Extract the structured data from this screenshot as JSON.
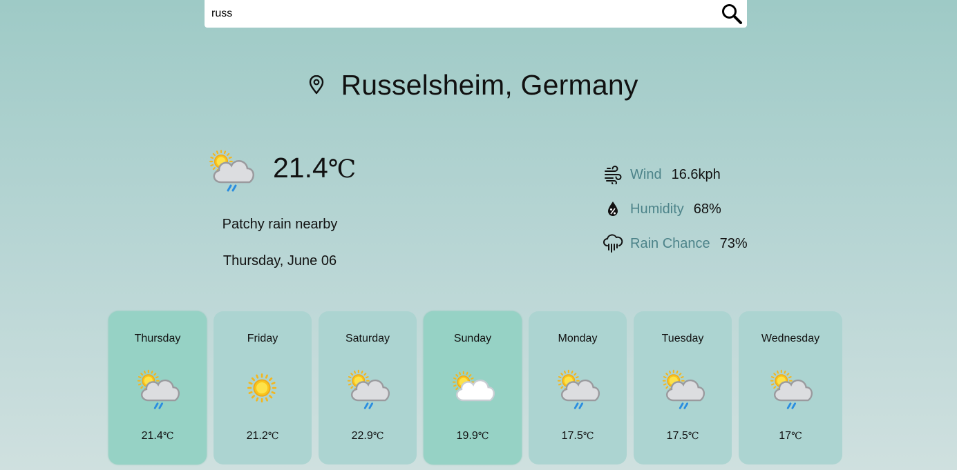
{
  "search": {
    "value": "russ",
    "icon": "search-icon"
  },
  "location": {
    "name": "Russelsheim, Germany",
    "icon": "map-pin-icon"
  },
  "current": {
    "temp": "21.4",
    "unit": "℃",
    "condition": "Patchy rain nearby",
    "date": "Thursday, June 06",
    "icon": "partly-cloudy-rain-icon"
  },
  "stats": [
    {
      "label": "Wind",
      "value": "16.6kph",
      "icon": "wind-icon"
    },
    {
      "label": "Humidity",
      "value": "68%",
      "icon": "humidity-drop-icon"
    },
    {
      "label": "Rain Chance",
      "value": "73%",
      "icon": "rain-cloud-icon"
    }
  ],
  "forecast": [
    {
      "day": "Thursday",
      "temp": "21.4",
      "unit": "℃",
      "icon": "partly-cloudy-rain-icon",
      "active": true
    },
    {
      "day": "Friday",
      "temp": "21.2",
      "unit": "℃",
      "icon": "sun-icon",
      "active": false
    },
    {
      "day": "Saturday",
      "temp": "22.9",
      "unit": "℃",
      "icon": "partly-cloudy-rain-icon",
      "active": false
    },
    {
      "day": "Sunday",
      "temp": "19.9",
      "unit": "℃",
      "icon": "partly-cloudy-icon",
      "active": true
    },
    {
      "day": "Monday",
      "temp": "17.5",
      "unit": "℃",
      "icon": "partly-cloudy-rain-icon",
      "active": false
    },
    {
      "day": "Tuesday",
      "temp": "17.5",
      "unit": "℃",
      "icon": "partly-cloudy-rain-icon",
      "active": false
    },
    {
      "day": "Wednesday",
      "temp": "17",
      "unit": "℃",
      "icon": "partly-cloudy-rain-icon",
      "active": false
    }
  ],
  "colors": {
    "accent_label": "#4c8389",
    "card": "#acd4d1",
    "card_active": "#96d2c5"
  }
}
